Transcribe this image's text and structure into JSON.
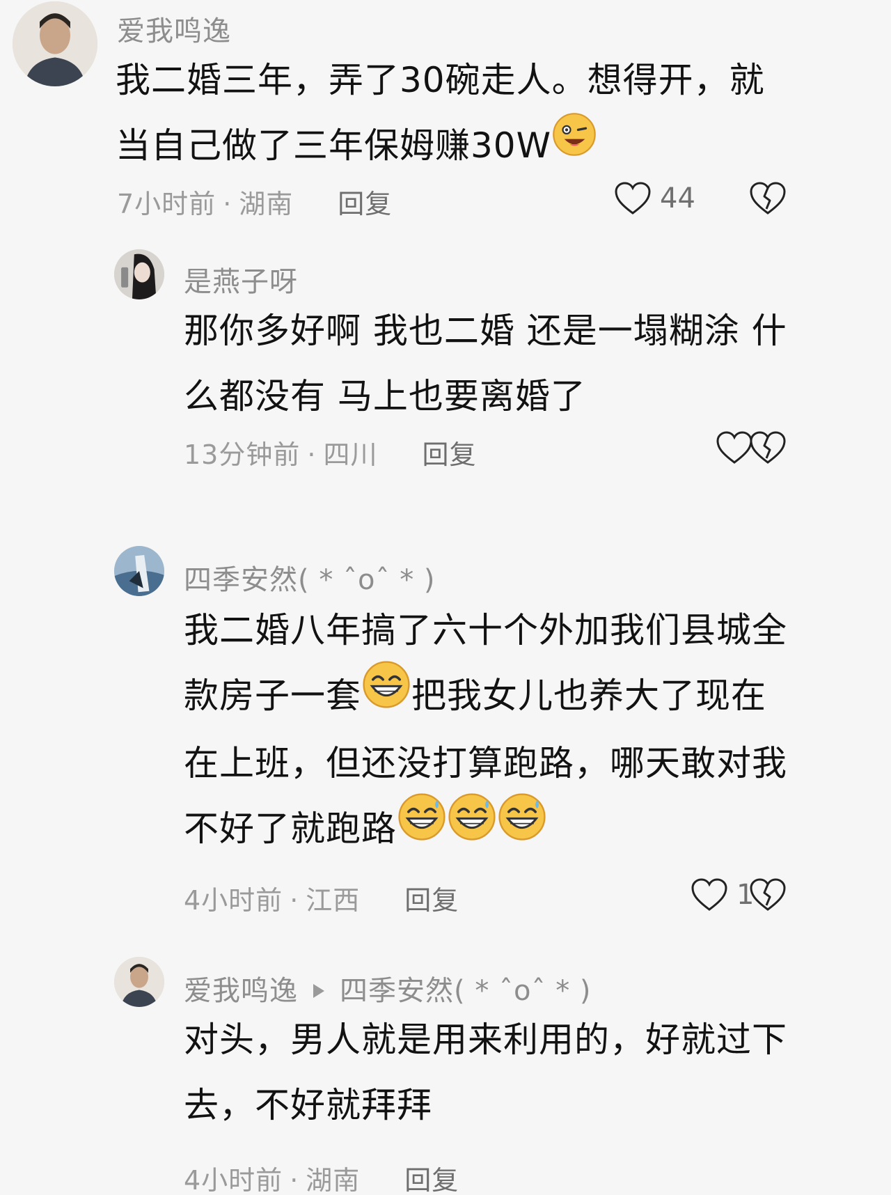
{
  "comments": [
    {
      "username": "爱我鸣逸",
      "text_lines": [
        "我二婚三年，弄了30碗走人。想得开，就",
        "当自己做了三年保姆赚30W"
      ],
      "emoji": "wink-laugh-emoji",
      "time": "7小时前",
      "location": "湖南",
      "reply_label": "回复",
      "likes": "44"
    },
    {
      "username": "是燕子呀",
      "text_lines": [
        "那你多好啊 我也二婚 还是一塌糊涂 什",
        "么都没有 马上也要离婚了"
      ],
      "time": "13分钟前",
      "location": "四川",
      "reply_label": "回复",
      "likes": ""
    },
    {
      "username": "四季安然(  *  ˆoˆ  *  )",
      "text_lines": [
        "我二婚八年搞了六十个外加我们县城全",
        "款房子一套",
        "把我女儿也养大了现在",
        "在上班，但还没打算跑路，哪天敢对我",
        "不好了就跑路"
      ],
      "emoji": "grin-sweat-emoji",
      "time": "4小时前",
      "location": "江西",
      "reply_label": "回复",
      "likes": "1"
    },
    {
      "username": "爱我鸣逸",
      "reply_to": "四季安然(  *  ˆoˆ  *  )",
      "text_lines": [
        "对头，男人就是用来利用的，好就过下",
        "去，不好就拜拜"
      ],
      "time": "4小时前",
      "location": "湖南",
      "reply_label": "回复"
    }
  ],
  "separator": "·",
  "icons": {
    "like": "heart-outline-icon",
    "dislike": "broken-heart-icon",
    "reply_arrow": "play-triangle-icon"
  },
  "colors": {
    "background": "#f6f6f6",
    "text": "#141414",
    "muted": "#9a9a9a",
    "username": "#8d8d8d"
  }
}
